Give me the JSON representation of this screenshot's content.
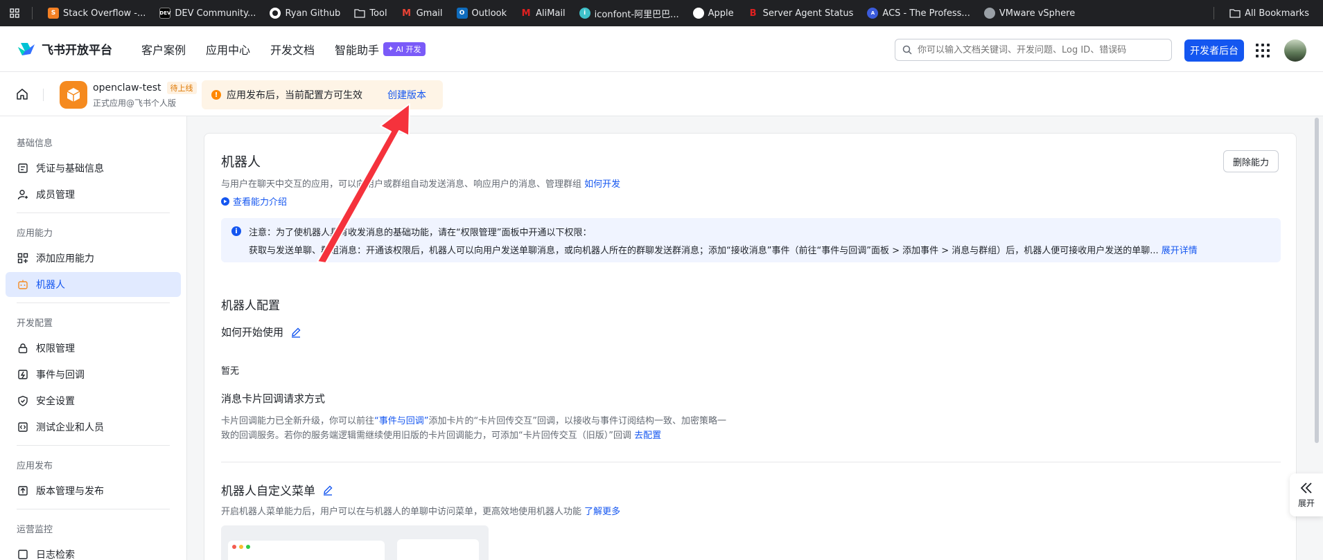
{
  "bookmarks": {
    "items": [
      {
        "label": "Stack Overflow -...",
        "icon": "stackoverflow-icon",
        "color": "#f48024"
      },
      {
        "label": "DEV Community...",
        "icon": "dev-icon",
        "color": "#000000"
      },
      {
        "label": "Ryan Github",
        "icon": "github-icon",
        "color": "#ffffff"
      },
      {
        "label": "Tool",
        "icon": "folder-icon",
        "color": "#e8eaed"
      },
      {
        "label": "Gmail",
        "icon": "gmail-icon",
        "color": "#ea4335"
      },
      {
        "label": "Outlook",
        "icon": "outlook-icon",
        "color": "#0f6cbd"
      },
      {
        "label": "AliMail",
        "icon": "alimail-icon",
        "color": "#e02020"
      },
      {
        "label": "iconfont-阿里巴巴...",
        "icon": "iconfont-icon",
        "color": "#3fc1c9"
      },
      {
        "label": "Apple",
        "icon": "apple-icon",
        "color": "#ffffff"
      },
      {
        "label": "Server Agent Status",
        "icon": "server-agent-icon",
        "color": "#e02020"
      },
      {
        "label": "ACS - The Profess...",
        "icon": "acs-icon",
        "color": "#3b5bdb"
      },
      {
        "label": "VMware vSphere",
        "icon": "globe-icon",
        "color": "#9aa0a6"
      }
    ],
    "all_bookmarks": "All Bookmarks"
  },
  "header": {
    "brand": "飞书开放平台",
    "nav": [
      "客户案例",
      "应用中心",
      "开发文档",
      "智能助手"
    ],
    "ai_badge": "AI 开发",
    "search_placeholder": "你可以输入文档关键词、开发问题、Log ID、错误码",
    "dev_console": "开发者后台"
  },
  "app": {
    "name": "openclaw-test",
    "status": "待上线",
    "subtitle": "正式应用@飞书个人版",
    "notice": "应用发布后，当前配置方可生效",
    "notice_action": "创建版本"
  },
  "sidebar": {
    "groups": [
      {
        "title": "基础信息",
        "items": [
          {
            "label": "凭证与基础信息",
            "icon": "credential-icon"
          },
          {
            "label": "成员管理",
            "icon": "member-add-icon"
          }
        ]
      },
      {
        "title": "应用能力",
        "items": [
          {
            "label": "添加应用能力",
            "icon": "add-capability-icon"
          },
          {
            "label": "机器人",
            "icon": "robot-icon",
            "active": true
          }
        ]
      },
      {
        "title": "开发配置",
        "items": [
          {
            "label": "权限管理",
            "icon": "lock-icon"
          },
          {
            "label": "事件与回调",
            "icon": "event-icon"
          },
          {
            "label": "安全设置",
            "icon": "shield-icon"
          },
          {
            "label": "测试企业和人员",
            "icon": "code-icon"
          }
        ]
      },
      {
        "title": "应用发布",
        "items": [
          {
            "label": "版本管理与发布",
            "icon": "publish-icon"
          }
        ]
      },
      {
        "title": "运营监控",
        "items": [
          {
            "label": "日志检索",
            "icon": "log-search-icon"
          }
        ]
      }
    ]
  },
  "main": {
    "title": "机器人",
    "desc": "与用户在聊天中交互的应用，可以向用户或群组自动发送消息、响应用户的消息、管理群组",
    "desc_link": "如何开发",
    "intro_link": "查看能力介绍",
    "delete_btn": "删除能力",
    "info_title": "注意：为了使机器人具有收发消息的基础功能，请在“权限管理”面板中开通以下权限：",
    "info_body": "获取与发送单聊、群组消息：开通该权限后，机器人可以向用户发送单聊消息，或向机器人所在的群聊发送群消息；添加“接收消息”事件（前往“事件与回调”面板 > 添加事件 > 消息与群组）后，机器人便可接收用户发送的单聊...",
    "info_more": "展开详情",
    "config_title": "机器人配置",
    "howto_title": "如何开始使用",
    "howto_value": "暂无",
    "card_cb_title": "消息卡片回调请求方式",
    "card_cb_line1_a": "卡片回调能力已全新升级，你可以前往",
    "card_cb_line1_link": "“事件与回调”",
    "card_cb_line1_b": "添加卡片的“卡片回传交互”回调，以接收与事件订阅结构一致、加密策略一",
    "card_cb_line2": "致的回调服务。若你的服务端逻辑需继续使用旧版的卡片回调能力，可添加“卡片回传交互（旧版）”回调",
    "card_cb_line2_link": "去配置",
    "menu_title": "机器人自定义菜单",
    "menu_desc": "开启机器人菜单能力后，用户可以在与机器人的单聊中访问菜单，更高效地使用机器人功能",
    "menu_link": "了解更多",
    "expand_label": "展开"
  },
  "colors": {
    "primary": "#1456f0",
    "warning": "#ff8800",
    "annotation_arrow": "#f5323c"
  }
}
